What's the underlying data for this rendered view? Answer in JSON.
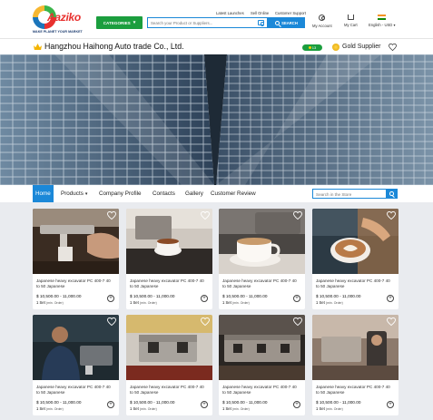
{
  "header": {
    "logo_text": "Aaziko",
    "logo_tagline": "MAKE PLANET YOUR MARKET",
    "categories_label": "CATEGORIES",
    "search_placeholder": "Search your Product or Suppliers...",
    "search_button": "SEARCH",
    "top_links": [
      "Latest Launches",
      "Sell Online",
      "Customer Support"
    ],
    "account_label": "My Account",
    "cart_label": "My Cart",
    "locale_label": "English - USD"
  },
  "store": {
    "name": "Hangzhou Haihong Auto trade Co., Ltd.",
    "years_badge": "13",
    "supplier_level": "Gold Supplier"
  },
  "nav": {
    "items": [
      {
        "label": "Home",
        "active": true
      },
      {
        "label": "Products",
        "has_dropdown": true
      },
      {
        "label": "Company Profile"
      },
      {
        "label": "Contacts"
      },
      {
        "label": "Gallery"
      },
      {
        "label": "Customer Review"
      }
    ],
    "search_placeholder": "Search in the Store"
  },
  "products": [
    {
      "title": "Japanese heavy excavator PC 400-7 40 to 50 Japanese",
      "price": "$ 10,500.00 - 11,000.00",
      "moq": "1 Set",
      "moq_note": "(min. Order)",
      "image": "espresso-pour"
    },
    {
      "title": "Japanese heavy excavator PC 400-7 40 to 50 Japanese",
      "price": "$ 10,500.00 - 11,000.00",
      "moq": "1 Set",
      "moq_note": "(min. Order)",
      "image": "espresso-cup-machine"
    },
    {
      "title": "Japanese heavy excavator PC 400-7 40 to 50 Japanese",
      "price": "$ 10,500.00 - 11,000.00",
      "moq": "1 Set",
      "moq_note": "(min. Order)",
      "image": "latte-cup"
    },
    {
      "title": "Japanese heavy excavator PC 400-7 40 to 50 Japanese",
      "price": "$ 10,500.00 - 11,000.00",
      "moq": "1 Set",
      "moq_note": "(min. Order)",
      "image": "latte-art"
    },
    {
      "title": "Japanese heavy excavator PC 400-7 40 to 50 Japanese",
      "price": "$ 10,500.00 - 11,000.00",
      "moq": "1 Set",
      "moq_note": "(min. Order)",
      "image": "barista"
    },
    {
      "title": "Japanese heavy excavator PC 400-7 40 to 50 Japanese",
      "price": "$ 10,500.00 - 11,000.00",
      "moq": "1 Set",
      "moq_note": "(min. Order)",
      "image": "red-espresso-machine"
    },
    {
      "title": "Japanese heavy excavator PC 400-7 40 to 50 Japanese",
      "price": "$ 10,500.00 - 11,000.00",
      "moq": "1 Set",
      "moq_note": "(min. Order)",
      "image": "espresso-machine-row"
    },
    {
      "title": "Japanese heavy excavator PC 400-7 40 to 50 Japanese",
      "price": "$ 10,500.00 - 11,000.00",
      "moq": "1 Set",
      "moq_note": "(min. Order)",
      "image": "cafe-counter"
    }
  ],
  "colors": {
    "brand_green": "#1b9e3e",
    "accent_blue": "#1b88d8",
    "gold": "#f4b400",
    "page_background": "#e9ebef"
  }
}
